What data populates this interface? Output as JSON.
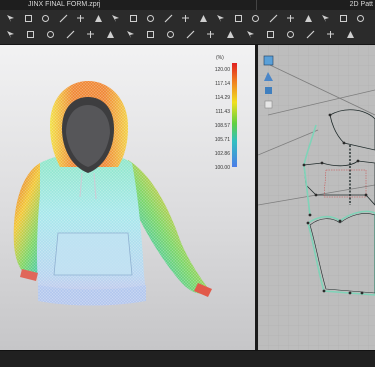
{
  "window": {
    "title_3d": "JINX FINAL FORM.zprj",
    "title_2d": "2D Patt"
  },
  "toolbar": {
    "row1_icons": [
      "select-icon",
      "transform-icon",
      "pin-icon",
      "hand-icon",
      "brush-icon",
      "pen-icon",
      "fold-icon",
      "steam-icon",
      "reflect-icon",
      "needle-icon",
      "avatar-icon",
      "tack-icon",
      "strap-icon",
      "point-icon",
      "arrange-icon",
      "pattern-select-icon",
      "edit-curve-icon",
      "layout-icon",
      "polygon-icon",
      "rect-icon",
      "ellipse-icon"
    ],
    "row2_icons": [
      "simulate-icon",
      "pin-box-icon",
      "grid-icon",
      "measure-icon",
      "texture-icon",
      "trim-icon",
      "seam-icon",
      "button-icon",
      "zip-icon",
      "topstitch-icon",
      "fit-map-icon",
      "garment-icon",
      "sew-icon",
      "edge-icon",
      "dart-icon",
      "notch-icon",
      "fold-line-icon",
      "grade-icon"
    ]
  },
  "legend": {
    "unit": "(%)",
    "labels": [
      "120.00",
      "117.14",
      "114.29",
      "111.43",
      "108.57",
      "105.71",
      "102.86",
      "100.00"
    ]
  },
  "colors": {
    "accent_seam": "#7fd3b8",
    "pattern_outline": "#1f2a2a"
  }
}
